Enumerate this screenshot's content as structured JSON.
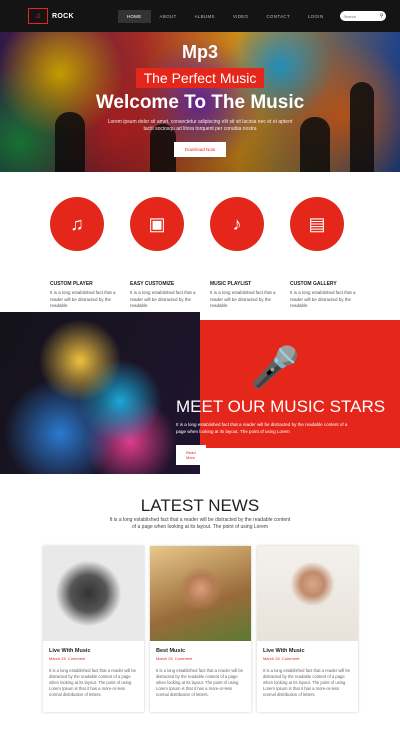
{
  "nav": {
    "logo_mark": "♫",
    "logo_text": "ROCK",
    "items": [
      "HOME",
      "ABOUT",
      "ALBUMS",
      "VIDEO",
      "CONTACT",
      "LOGIN"
    ],
    "search_placeholder": "Search",
    "search_icon": "search-icon"
  },
  "hero": {
    "kicker": "Mp3",
    "tagline": "The Perfect Music",
    "title": "Welcome To The Music",
    "description": "Lorem ipsum dolor sit amet, consectetur adipiscing elit sit sit lacinia nec et et aptent taciti sociosqu ad litora torquent per conubia nostra",
    "button": "Download Now"
  },
  "features": [
    {
      "icon": "music-note-icon",
      "glyph": "♫",
      "title": "CUSTOM PLAYER",
      "desc": "It is a long established fact that a reader will be distracted by the readable"
    },
    {
      "icon": "wallet-icon",
      "glyph": "▣",
      "title": "EASY CUSTOMIZE",
      "desc": "It is a long established fact that a reader will be distracted by the readable"
    },
    {
      "icon": "playlist-icon",
      "glyph": "♪",
      "title": "MUSIC PLAYLIST",
      "desc": "It is a long established fact that a reader will be distracted by the readable"
    },
    {
      "icon": "gallery-icon",
      "glyph": "▤",
      "title": "CUSTOM GALLERY",
      "desc": "It is a long established fact that a reader will be distracted by the readable"
    }
  ],
  "stars": {
    "icon": "microphone-icon",
    "title": "MEET OUR MUSIC STARS",
    "description": "It is a long established fact that a reader will be distracted by the readable content of a page when looking at its layout. The point of using Lorem",
    "button": "Read More"
  },
  "news": {
    "title": "LATEST NEWS",
    "subtitle": "It is a long established fact that a reader will be distracted by the readable content of a page when looking at its layout. The point of using Lorem",
    "cards": [
      {
        "title": "Live With Music",
        "date": "March 25",
        "comment": "Comment",
        "desc": "It is a long established fact that a reader will be distracted by the readable content of a page when looking at its layout. The point of using Lorem Ipsum is that it has a more-or-less normal distribution of letters."
      },
      {
        "title": "Best Music",
        "date": "March 25",
        "comment": "Comment",
        "desc": "It is a long established fact that a reader will be distracted by the readable content of a page when looking at its layout. The point of using Lorem Ipsum is that it has a more-or-less normal distribution of letters."
      },
      {
        "title": "Live With Music",
        "date": "March 25",
        "comment": "Comment",
        "desc": "It is a long established fact that a reader will be distracted by the readable content of a page when looking at its layout. The point of using Lorem Ipsum is that it has a more-or-less normal distribution of letters."
      }
    ]
  },
  "colors": {
    "accent": "#e5261b",
    "nav_bg": "#141414"
  }
}
